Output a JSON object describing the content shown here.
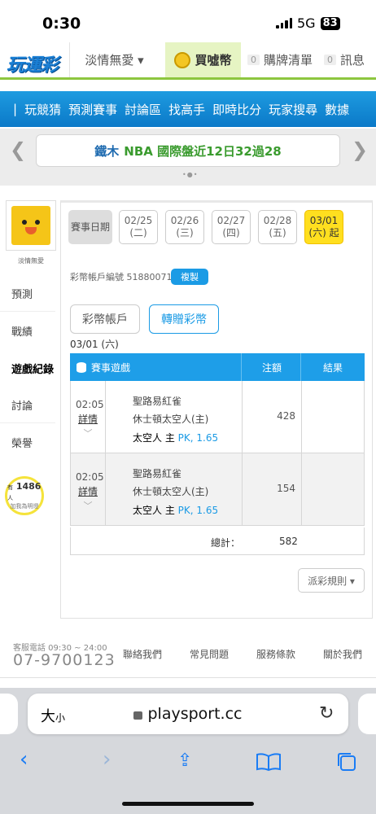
{
  "status_bar": {
    "time": "0:30",
    "network": "5G",
    "battery": "83"
  },
  "header": {
    "logo": "玩運彩",
    "user_dropdown": "淡情無愛 ▾",
    "buy_coin": "買噓幣",
    "purchase_count": "0",
    "purchase_label": "購牌清單",
    "message_count": "0",
    "message_label": "訊息"
  },
  "nav": {
    "items": [
      "玩競猜",
      "預測賽事",
      "討論區",
      "找高手",
      "即時比分",
      "玩家搜尋",
      "數據"
    ]
  },
  "ticker": {
    "team": "鐵木",
    "text": "NBA 國際盤近12日32過28"
  },
  "sidebar": {
    "username": "淡情無愛",
    "items": [
      "預測",
      "戰績",
      "遊戲紀錄",
      "討論",
      "榮譽"
    ],
    "help_prefix": "有",
    "help_count": "1486",
    "help_suffix": "人",
    "help_text": "加我為明燈"
  },
  "date_picker": {
    "label": "賽事日期",
    "days": [
      {
        "date": "02/25",
        "weekday": "(二)"
      },
      {
        "date": "02/26",
        "weekday": "(三)"
      },
      {
        "date": "02/27",
        "weekday": "(四)"
      },
      {
        "date": "02/28",
        "weekday": "(五)"
      },
      {
        "date": "03/01",
        "weekday": "(六) 起"
      }
    ]
  },
  "account": {
    "label": "彩幣帳戶編號 51880071",
    "copy_button": "複製"
  },
  "tabs": {
    "account": "彩幣帳戶",
    "transfer": "轉贈彩幣"
  },
  "current_date": "03/01 (六)",
  "table": {
    "headers": {
      "game": "賽事遊戲",
      "amount": "注額",
      "result": "結果"
    },
    "rows": [
      {
        "time": "02:05",
        "detail": "詳情",
        "away": "聖路易紅雀",
        "home": "休士頓太空人(主)",
        "pick_team": "太空人 主",
        "pick_odds": "PK, 1.65",
        "amount": "428",
        "result": ""
      },
      {
        "time": "02:05",
        "detail": "詳情",
        "away": "聖路易紅雀",
        "home": "休士頓太空人(主)",
        "pick_team": "太空人 主",
        "pick_odds": "PK, 1.65",
        "amount": "154",
        "result": ""
      }
    ],
    "total_label": "總計：",
    "total": "582"
  },
  "rules_button": "派彩規則 ▾",
  "footer": {
    "phone_label": "客服電話 09:30 ~ 24:00",
    "phone": "07-9700123",
    "links": [
      "聯絡我們",
      "常見問題",
      "服務條款",
      "關於我們"
    ]
  },
  "browser": {
    "text_size": "大",
    "text_size_small": "小",
    "url": "playsport.cc"
  },
  "colors": {
    "accent_blue": "#1b9be5",
    "brand_green": "#8dc63f",
    "highlight_yellow": "#ffdf1f"
  }
}
